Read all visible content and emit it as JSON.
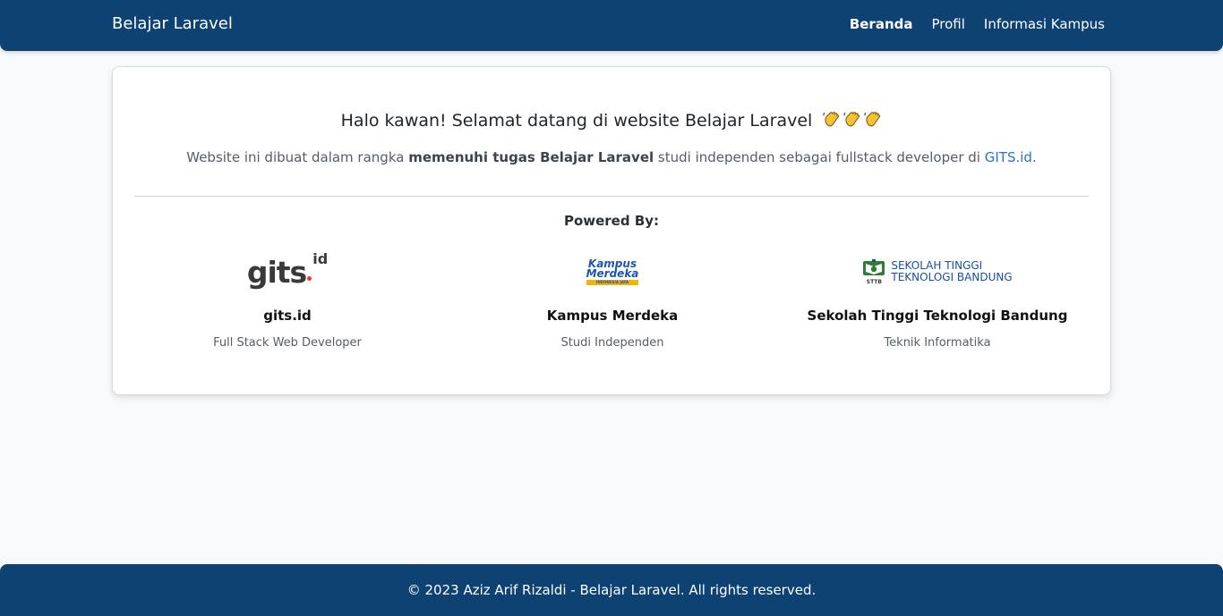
{
  "navbar": {
    "brand": "Belajar Laravel",
    "links": [
      {
        "label": "Beranda",
        "active": true
      },
      {
        "label": "Profil",
        "active": false
      },
      {
        "label": "Informasi Kampus",
        "active": false
      }
    ]
  },
  "welcome": {
    "headline": "Halo kawan! Selamat datang di website Belajar Laravel",
    "headline_emoji": "waving-hands-icon",
    "lead_before": "Website ini dibuat dalam rangka ",
    "lead_bold": "memenuhi tugas Belajar Laravel",
    "lead_after": " studi independen sebagai fullstack developer di ",
    "lead_link": "GITS.id",
    "lead_end": "."
  },
  "powered_by": {
    "label": "Powered By:",
    "partners": [
      {
        "logo_text": "gits",
        "logo_sup": "id",
        "name": "gits.id",
        "desc": "Full Stack Web Developer"
      },
      {
        "logo_line1": "Kampus",
        "logo_line2": "Merdeka",
        "logo_tag": "INDONESIA JAYA",
        "name": "Kampus Merdeka",
        "desc": "Studi Independen"
      },
      {
        "logo_line1": "SEKOLAH TINGGI",
        "logo_line2": "TEKNOLOGI BANDUNG",
        "logo_tag": "STTB",
        "name": "Sekolah Tinggi Teknologi Bandung",
        "desc": "Teknik Informatika"
      }
    ]
  },
  "footer": {
    "text": "© 2023 Aziz Arif Rizaldi - Belajar Laravel. All rights reserved."
  },
  "colors": {
    "primary": "#0d4273",
    "background": "#f8f9fa",
    "link": "#2a6fd6"
  }
}
